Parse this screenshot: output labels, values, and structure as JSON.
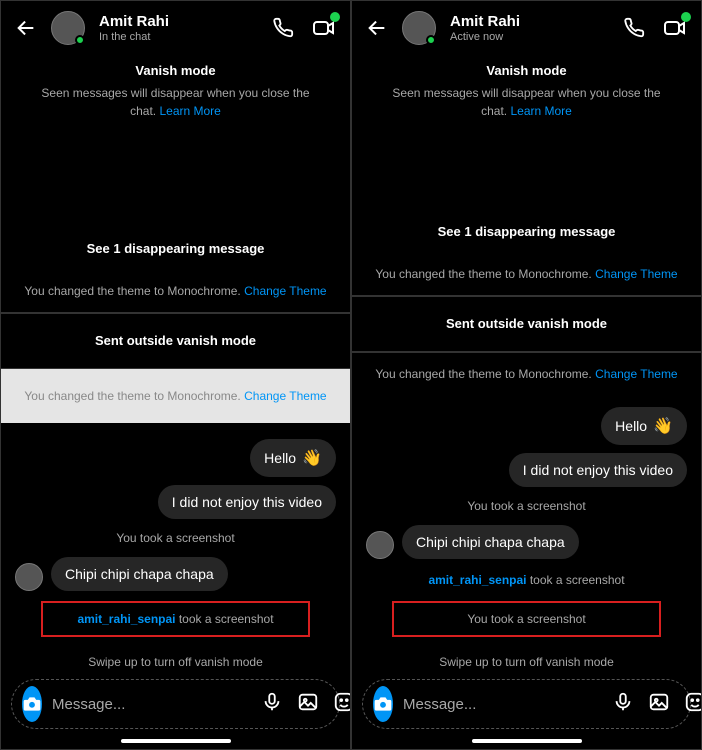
{
  "panels": [
    {
      "header": {
        "name": "Amit Rahi",
        "status": "In the chat"
      },
      "vanish": {
        "title": "Vanish mode",
        "text": "Seen messages will disappear when you close the chat.",
        "learn": "Learn More"
      },
      "disappearing_msg": "See 1 disappearing message",
      "theme1": {
        "text": "You changed the theme to Monochrome.",
        "link": "Change Theme"
      },
      "outside_label": "Sent outside vanish mode",
      "theme2": {
        "text": "You changed the theme to Monochrome.",
        "link": "Change Theme",
        "highlighted": true
      },
      "msg_hello": "Hello",
      "msg_enjoy": "I did not enjoy this video",
      "screenshot_self": "You took a screenshot",
      "msg_chipi": "Chipi chipi chapa chapa",
      "highlight": {
        "user": "amit_rahi_senpai",
        "rest": " took a screenshot"
      },
      "swipe": "Swipe up to turn off vanish mode",
      "placeholder": "Message..."
    },
    {
      "header": {
        "name": "Amit Rahi",
        "status": "Active now"
      },
      "vanish": {
        "title": "Vanish mode",
        "text": "Seen messages will disappear when you close the chat.",
        "learn": "Learn More"
      },
      "disappearing_msg": "See 1 disappearing message",
      "theme1": {
        "text": "You changed the theme to Monochrome.",
        "link": "Change Theme"
      },
      "outside_label": "Sent outside vanish mode",
      "theme2": {
        "text": "You changed the theme to Monochrome.",
        "link": "Change Theme",
        "highlighted": false
      },
      "msg_hello": "Hello",
      "msg_enjoy": "I did not enjoy this video",
      "screenshot_self": "You took a screenshot",
      "msg_chipi": "Chipi chipi chapa chapa",
      "highlight": {
        "user": "",
        "rest": "You took a screenshot"
      },
      "swipe": "Swipe up to turn off vanish mode",
      "placeholder": "Message..."
    }
  ]
}
